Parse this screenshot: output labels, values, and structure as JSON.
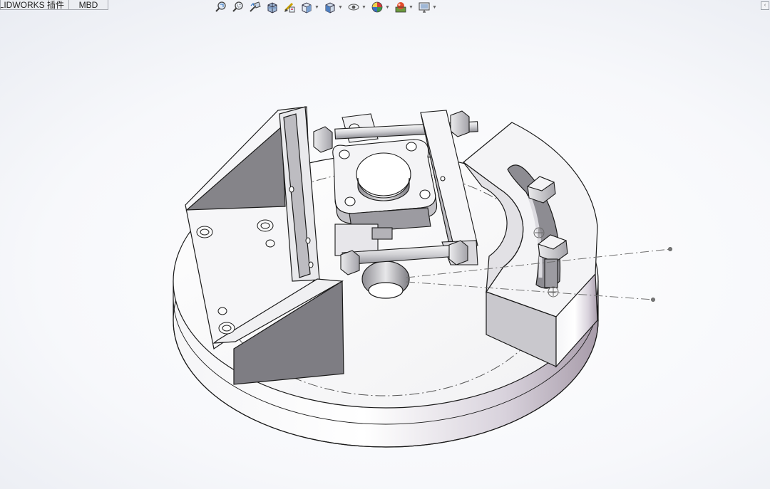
{
  "tabs": [
    {
      "label": "SOLIDWORKS 插件"
    },
    {
      "label": "MBD"
    }
  ],
  "toolbar": {
    "icons": [
      "zoom-to-fit-icon",
      "zoom-to-area-icon",
      "previous-view-icon",
      "section-view-icon",
      "dynamic-annotation-icon",
      "view-orientation-icon",
      "display-style-icon",
      "hide-show-items-icon",
      "edit-appearance-icon",
      "apply-scene-icon",
      "view-settings-icon"
    ]
  },
  "corner_button": {
    "label": "‹"
  },
  "colors": {
    "part_face_light": "#f2f2f4",
    "part_face_mid": "#b8b8bd",
    "part_face_dark": "#85848a",
    "edge": "#1a1a1a",
    "accent_purple": "#c7bccb"
  }
}
